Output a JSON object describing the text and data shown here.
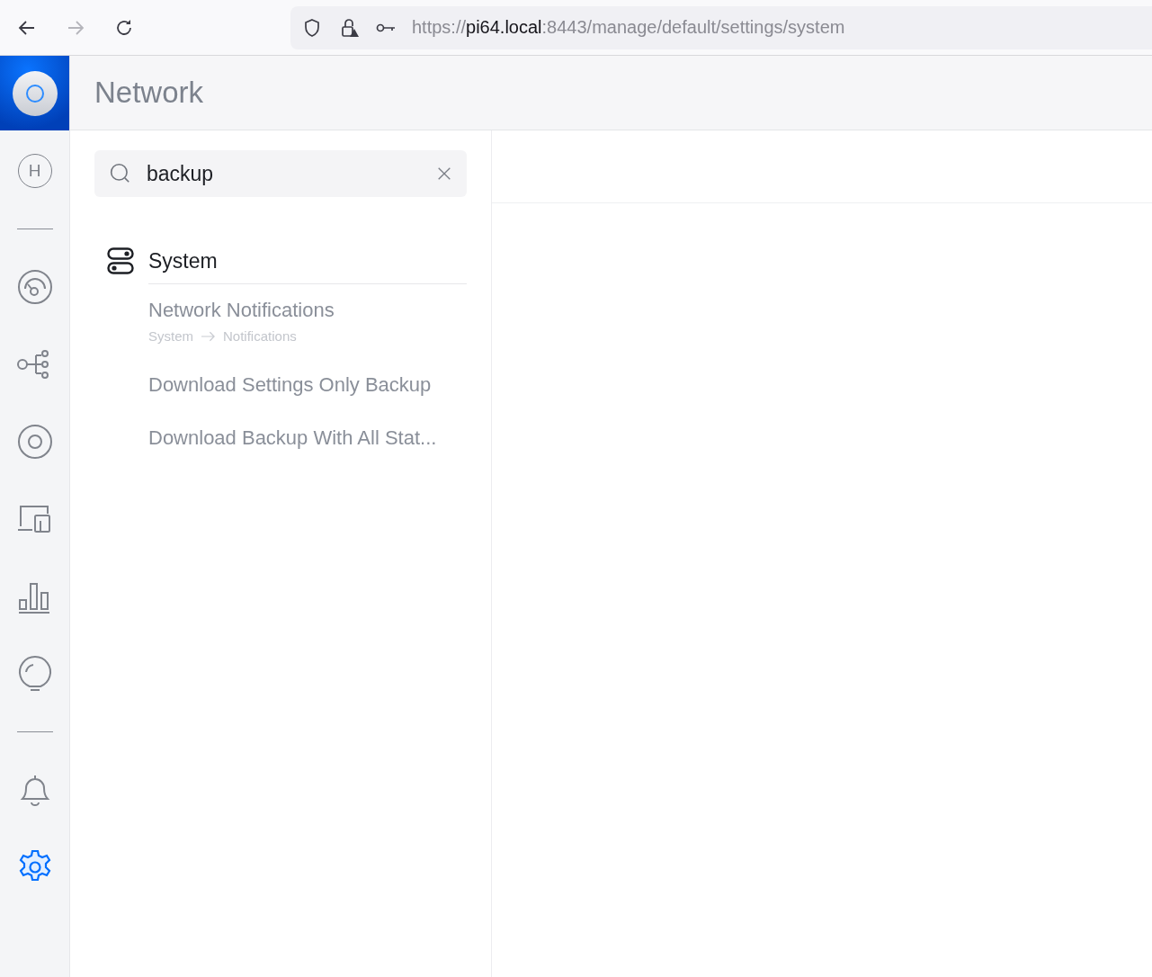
{
  "browser": {
    "url": {
      "scheme": "https://",
      "host": "pi64.local",
      "path": ":8443/manage/default/settings/system"
    }
  },
  "app": {
    "title": "Network"
  },
  "sidebar": {
    "items": [
      {
        "kind": "home",
        "label": "H",
        "selected": false
      },
      {
        "kind": "divider"
      },
      {
        "kind": "dashboard",
        "selected": false
      },
      {
        "kind": "topology",
        "selected": false
      },
      {
        "kind": "devices",
        "selected": false
      },
      {
        "kind": "clients",
        "selected": false
      },
      {
        "kind": "statistics",
        "selected": false
      },
      {
        "kind": "insights",
        "selected": false
      },
      {
        "kind": "divider"
      },
      {
        "kind": "alerts",
        "selected": false
      },
      {
        "kind": "settings",
        "selected": true
      }
    ]
  },
  "search": {
    "value": "backup"
  },
  "results": {
    "section": "System",
    "items": [
      {
        "title": "Network Notifications",
        "path": [
          "System",
          "Notifications"
        ]
      },
      {
        "title": "Download Settings Only Backup"
      },
      {
        "title": "Download Backup With All Stat..."
      }
    ]
  }
}
